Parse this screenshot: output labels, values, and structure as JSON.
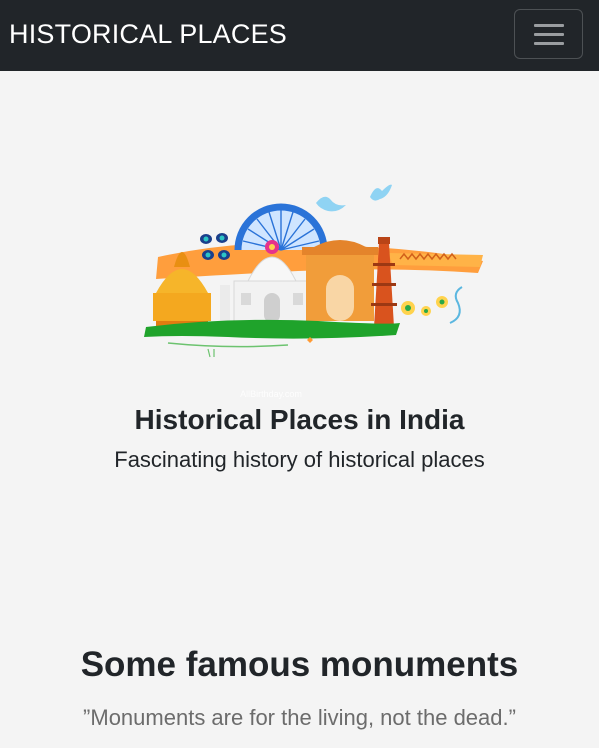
{
  "navbar": {
    "brand": "HISTORICAL PLACES",
    "toggle_icon": "hamburger-menu-icon"
  },
  "hero": {
    "image_subject": "illustration of Indian monuments (Taj Mahal, India Gate, Qutub Minar, temple) with Ashoka Chakra and tricolor brush strokes",
    "watermark": "AllBirthday.com",
    "title": "Historical Places in India",
    "subtitle": "Fascinating history of historical places"
  },
  "monuments": {
    "title": "Some famous monuments",
    "quote": "”Monuments are for the living, not the dead.”"
  },
  "colors": {
    "navbar_bg": "#212529",
    "page_bg": "#f4f4f4",
    "saffron": "#ff9933",
    "green": "#1fa32b",
    "chakra_blue": "#2a73d8"
  }
}
